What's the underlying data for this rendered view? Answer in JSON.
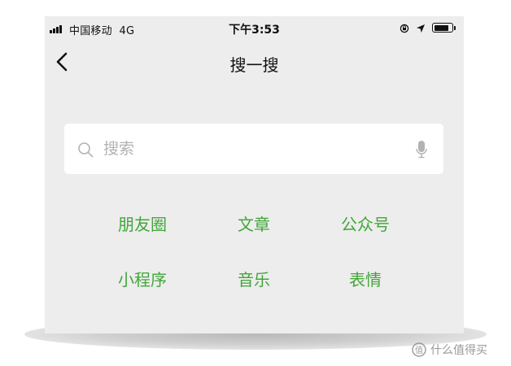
{
  "status_bar": {
    "carrier": "中国移动",
    "network": "4G",
    "time": "下午3:53",
    "battery_level": 0.85
  },
  "nav": {
    "title": "搜一搜",
    "back_icon": "chevron-left-icon"
  },
  "search": {
    "placeholder": "搜索",
    "value": "",
    "left_icon": "search-icon",
    "right_icon": "microphone-icon"
  },
  "categories": [
    {
      "label": "朋友圈"
    },
    {
      "label": "文章"
    },
    {
      "label": "公众号"
    },
    {
      "label": "小程序"
    },
    {
      "label": "音乐"
    },
    {
      "label": "表情"
    }
  ],
  "colors": {
    "accent": "#41a63a",
    "background": "#ededed",
    "search_box": "#ffffff",
    "placeholder": "#b2b2b2"
  },
  "watermark": {
    "text": "什么值得买"
  }
}
